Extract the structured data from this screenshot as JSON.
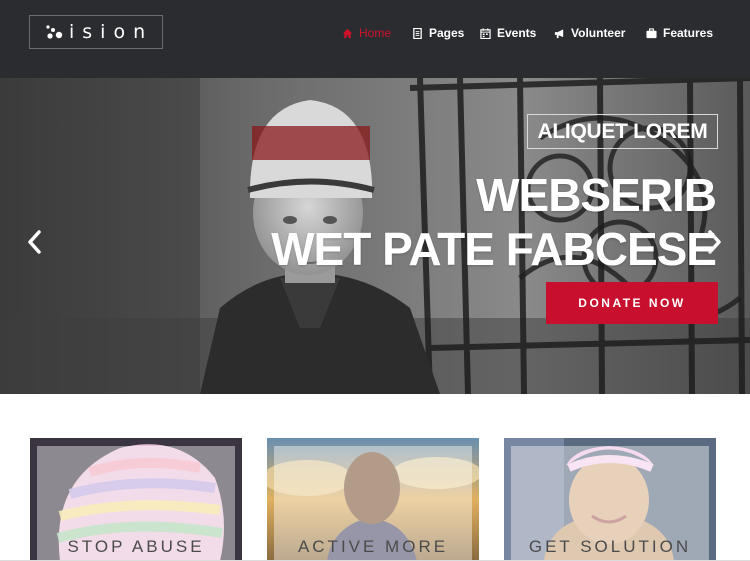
{
  "logo": {
    "text": "ision"
  },
  "nav": {
    "items": [
      {
        "label": "Home",
        "icon": "home-icon",
        "active": true
      },
      {
        "label": "Pages",
        "icon": "document-icon",
        "active": false
      },
      {
        "label": "Events",
        "icon": "calendar-icon",
        "active": false
      },
      {
        "label": "Volunteer",
        "icon": "megaphone-icon",
        "active": false
      },
      {
        "label": "Features",
        "icon": "briefcase-icon",
        "active": false
      }
    ]
  },
  "hero": {
    "tag": "ALIQUET LOREM",
    "title_line1": "WEBSERIB",
    "title_line2": "WET PATE FABCESE",
    "button": "DONATE NOW"
  },
  "cards": [
    {
      "label": "STOP ABUSE"
    },
    {
      "label": "ACTIVE MORE"
    },
    {
      "label": "GET SOLUTION"
    }
  ],
  "colors": {
    "header_bg": "#2b2c30",
    "accent": "#c8102e",
    "active_nav": "#d0112b"
  }
}
